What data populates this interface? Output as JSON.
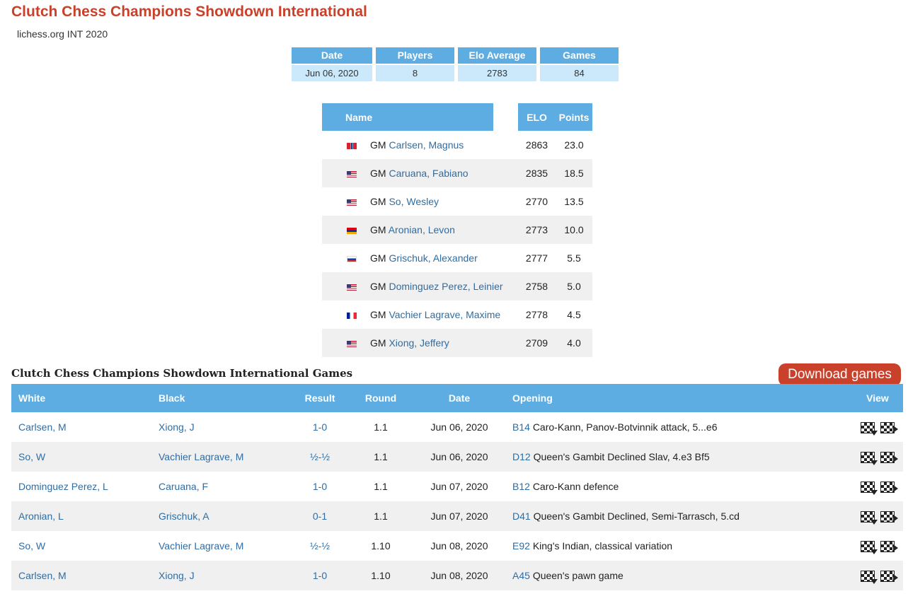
{
  "page": {
    "title": "Clutch Chess Champions Showdown International",
    "subtitle": "lichess.org INT 2020"
  },
  "summary": [
    {
      "label": "Date",
      "value": "Jun 06, 2020"
    },
    {
      "label": "Players",
      "value": "8"
    },
    {
      "label": "Elo Average",
      "value": "2783"
    },
    {
      "label": "Games",
      "value": "84"
    }
  ],
  "standings": {
    "headers": {
      "name": "Name",
      "elo": "ELO",
      "points": "Points"
    },
    "rows": [
      {
        "flag": "norway-flag-icon",
        "title": "GM",
        "name": "Carlsen, Magnus",
        "elo": "2863",
        "points": "23.0"
      },
      {
        "flag": "usa-flag-icon",
        "title": "GM",
        "name": "Caruana, Fabiano",
        "elo": "2835",
        "points": "18.5"
      },
      {
        "flag": "usa-flag-icon",
        "title": "GM",
        "name": "So, Wesley",
        "elo": "2770",
        "points": "13.5"
      },
      {
        "flag": "armenia-flag-icon",
        "title": "GM",
        "name": "Aronian, Levon",
        "elo": "2773",
        "points": "10.0"
      },
      {
        "flag": "russia-flag-icon",
        "title": "GM",
        "name": "Grischuk, Alexander",
        "elo": "2777",
        "points": "5.5"
      },
      {
        "flag": "usa-flag-icon",
        "title": "GM",
        "name": "Dominguez Perez, Leinier",
        "elo": "2758",
        "points": "5.0"
      },
      {
        "flag": "france-flag-icon",
        "title": "GM",
        "name": "Vachier Lagrave, Maxime",
        "elo": "2778",
        "points": "4.5"
      },
      {
        "flag": "usa-flag-icon",
        "title": "GM",
        "name": "Xiong, Jeffery",
        "elo": "2709",
        "points": "4.0"
      }
    ]
  },
  "games": {
    "title": "Clutch Chess Champions Showdown International Games",
    "download_label": "Download games",
    "headers": {
      "white": "White",
      "black": "Black",
      "result": "Result",
      "round": "Round",
      "date": "Date",
      "opening": "Opening",
      "view": "View"
    },
    "rows": [
      {
        "white": "Carlsen, M",
        "black": "Xiong, J",
        "result": "1-0",
        "round": "1.1",
        "date": "Jun 06, 2020",
        "eco": "B14",
        "opening": "Caro-Kann, Panov-Botvinnik attack, 5...e6"
      },
      {
        "white": "So, W",
        "black": "Vachier Lagrave, M",
        "result": "½-½",
        "round": "1.1",
        "date": "Jun 06, 2020",
        "eco": "D12",
        "opening": "Queen's Gambit Declined Slav, 4.e3 Bf5"
      },
      {
        "white": "Dominguez Perez, L",
        "black": "Caruana, F",
        "result": "1-0",
        "round": "1.1",
        "date": "Jun 07, 2020",
        "eco": "B12",
        "opening": "Caro-Kann defence"
      },
      {
        "white": "Aronian, L",
        "black": "Grischuk, A",
        "result": "0-1",
        "round": "1.1",
        "date": "Jun 07, 2020",
        "eco": "D41",
        "opening": "Queen's Gambit Declined, Semi-Tarrasch, 5.cd"
      },
      {
        "white": "So, W",
        "black": "Vachier Lagrave, M",
        "result": "½-½",
        "round": "1.10",
        "date": "Jun 08, 2020",
        "eco": "E92",
        "opening": "King's Indian, classical variation"
      },
      {
        "white": "Carlsen, M",
        "black": "Xiong, J",
        "result": "1-0",
        "round": "1.10",
        "date": "Jun 08, 2020",
        "eco": "A45",
        "opening": "Queen's pawn game"
      }
    ]
  }
}
